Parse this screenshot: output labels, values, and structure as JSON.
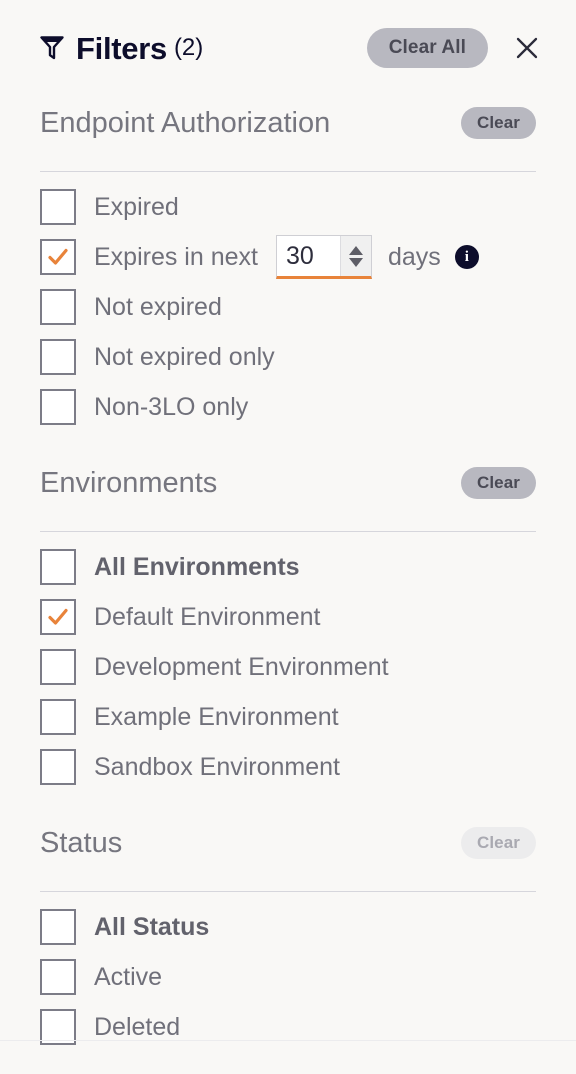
{
  "header": {
    "filter_icon": "filter-funnel-icon",
    "title": "Filters",
    "count": "(2)",
    "clear_all_label": "Clear All",
    "close_icon": "close-icon"
  },
  "accent_color": "#E8833A",
  "sections": [
    {
      "id": "endpoint-authorization",
      "title": "Endpoint Authorization",
      "clear_label": "Clear",
      "clear_enabled": true,
      "options": [
        {
          "label": "Expired",
          "checked": false,
          "bold": false
        },
        {
          "label": "Expires in next",
          "checked": true,
          "bold": false,
          "control": {
            "type": "number-stepper",
            "value": "30",
            "suffix": "days",
            "info_icon": "info-icon"
          }
        },
        {
          "label": "Not expired",
          "checked": false,
          "bold": false
        },
        {
          "label": "Not expired only",
          "checked": false,
          "bold": false
        },
        {
          "label": "Non-3LO only",
          "checked": false,
          "bold": false
        }
      ]
    },
    {
      "id": "environments",
      "title": "Environments",
      "clear_label": "Clear",
      "clear_enabled": true,
      "options": [
        {
          "label": "All Environments",
          "checked": false,
          "bold": true
        },
        {
          "label": "Default Environment",
          "checked": true,
          "bold": false
        },
        {
          "label": "Development Environment",
          "checked": false,
          "bold": false
        },
        {
          "label": "Example Environment",
          "checked": false,
          "bold": false
        },
        {
          "label": "Sandbox Environment",
          "checked": false,
          "bold": false
        }
      ]
    },
    {
      "id": "status",
      "title": "Status",
      "clear_label": "Clear",
      "clear_enabled": false,
      "options": [
        {
          "label": "All Status",
          "checked": false,
          "bold": true
        },
        {
          "label": "Active",
          "checked": false,
          "bold": false
        },
        {
          "label": "Deleted",
          "checked": false,
          "bold": false
        }
      ]
    }
  ]
}
